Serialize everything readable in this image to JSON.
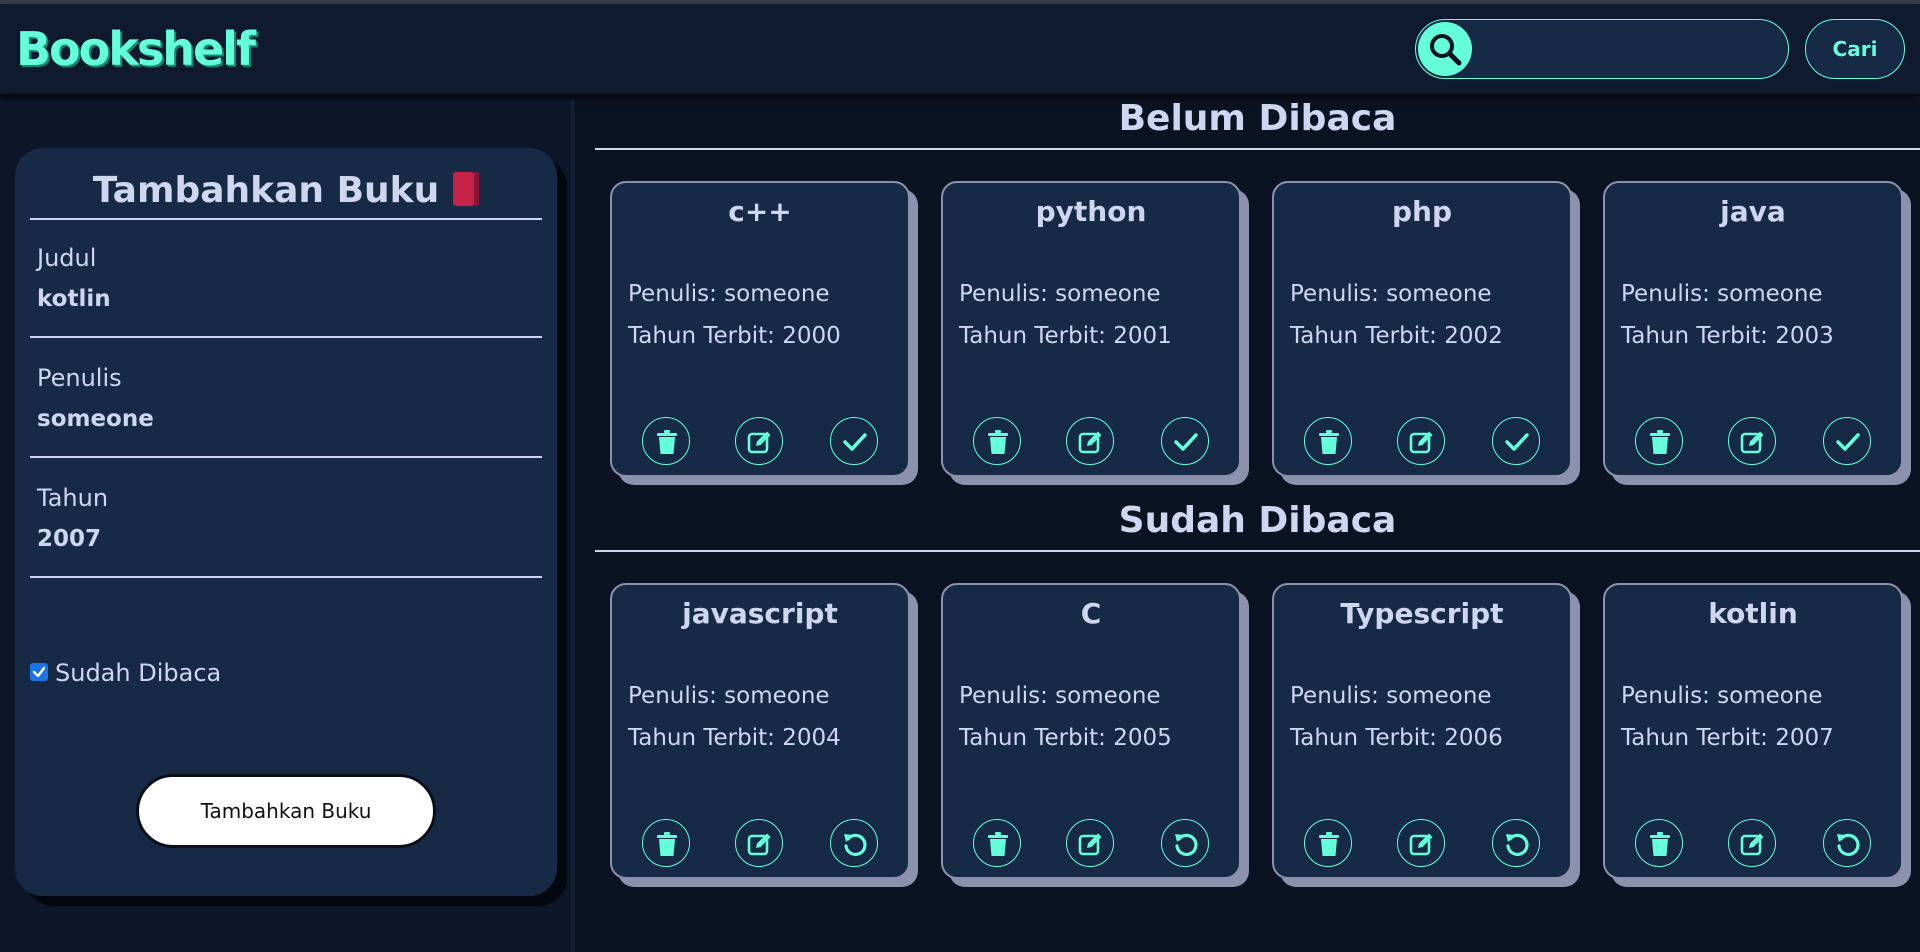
{
  "app": {
    "brand": "Bookshelf"
  },
  "header": {
    "search_placeholder": "",
    "search_button": "Cari"
  },
  "form": {
    "title": "Tambahkan Buku",
    "fields": [
      {
        "label": "Judul",
        "value": "kotlin"
      },
      {
        "label": "Penulis",
        "value": "someone"
      },
      {
        "label": "Tahun",
        "value": "2007"
      }
    ],
    "checkbox_label": "Sudah Dibaca",
    "checkbox_checked": true,
    "submit_label": "Tambahkan Buku"
  },
  "unread": {
    "title": "Belum Dibaca",
    "books": [
      {
        "title": "c++",
        "author": "Penulis: someone",
        "year": "Tahun Terbit: 2000"
      },
      {
        "title": "python",
        "author": "Penulis: someone",
        "year": "Tahun Terbit: 2001"
      },
      {
        "title": "php",
        "author": "Penulis: someone",
        "year": "Tahun Terbit: 2002"
      },
      {
        "title": "java",
        "author": "Penulis: someone",
        "year": "Tahun Terbit: 2003"
      }
    ]
  },
  "read": {
    "title": "Sudah Dibaca",
    "books": [
      {
        "title": "javascript",
        "author": "Penulis: someone",
        "year": "Tahun Terbit: 2004"
      },
      {
        "title": "C",
        "author": "Penulis: someone",
        "year": "Tahun Terbit: 2005"
      },
      {
        "title": "Typescript",
        "author": "Penulis: someone",
        "year": "Tahun Terbit: 2006"
      },
      {
        "title": "kotlin",
        "author": "Penulis: someone",
        "year": "Tahun Terbit: 2007"
      }
    ]
  },
  "colors": {
    "accent": "#64ffda",
    "card": "#172a45",
    "background": "#0b1221",
    "text": "#cfd6f0"
  },
  "icons": {
    "search": "search-icon",
    "delete": "trash-icon",
    "edit": "edit-icon",
    "done": "check-icon",
    "undo": "undo-icon"
  }
}
